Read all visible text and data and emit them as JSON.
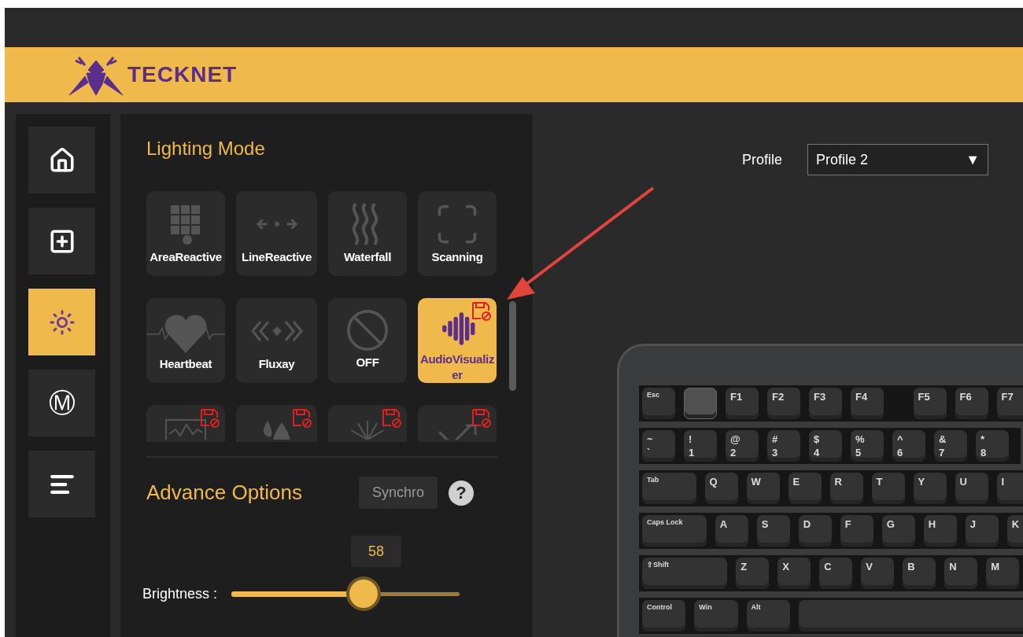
{
  "header": {
    "brand": "TECKNET"
  },
  "sidebar": {
    "items": [
      {
        "kind": "home",
        "selected": false
      },
      {
        "kind": "add",
        "selected": false
      },
      {
        "kind": "light",
        "selected": true
      },
      {
        "kind": "macro",
        "glyph": "Ⓜ",
        "selected": false
      },
      {
        "kind": "list",
        "selected": false
      }
    ]
  },
  "lighting_mode": {
    "title": "Lighting Mode",
    "modes": [
      {
        "kind": "grid",
        "label": "AreaReactive",
        "selected": false,
        "saved": false
      },
      {
        "kind": "line",
        "label": "LineReactive",
        "selected": false,
        "saved": false
      },
      {
        "kind": "waves",
        "label": "Waterfall",
        "selected": false,
        "saved": false
      },
      {
        "kind": "scan",
        "label": "Scanning",
        "selected": false,
        "saved": false
      },
      {
        "kind": "heart",
        "label": "Heartbeat",
        "selected": false,
        "saved": false
      },
      {
        "kind": "chevrons",
        "label": "Fluxay",
        "selected": false,
        "saved": false
      },
      {
        "kind": "off",
        "label": "OFF",
        "selected": false,
        "saved": false
      },
      {
        "kind": "audio",
        "label": "AudioVisualizer",
        "selected": true,
        "saved": true
      },
      {
        "kind": "pulse",
        "selected": false,
        "saved": true
      },
      {
        "kind": "drops",
        "selected": false,
        "saved": true
      },
      {
        "kind": "burst",
        "selected": false,
        "saved": true
      },
      {
        "kind": "arrow",
        "selected": false,
        "saved": true
      }
    ]
  },
  "advance_options": {
    "title": "Advance Options",
    "synchro_button": "Synchro",
    "help": "?",
    "brightness": {
      "label": "Brightness :",
      "value": "58",
      "level": 0.58
    }
  },
  "profile": {
    "label": "Profile",
    "value": "Profile 2",
    "caret": "▼"
  },
  "keyboard": {
    "function_row": [
      {
        "kind": "key",
        "label": "Esc"
      },
      {
        "kind": "blank"
      },
      {
        "kind": "key",
        "label": "F1"
      },
      {
        "kind": "key",
        "label": "F2"
      },
      {
        "kind": "key",
        "label": "F3"
      },
      {
        "kind": "key",
        "label": "F4"
      },
      {
        "kind": "gap"
      },
      {
        "kind": "key",
        "label": "F5"
      },
      {
        "kind": "key",
        "label": "F6"
      },
      {
        "kind": "key",
        "label": "F7"
      }
    ],
    "number_row": [
      {
        "kind": "key",
        "label": "~",
        "sub": "`"
      },
      {
        "kind": "key",
        "label": "!",
        "sub": "1"
      },
      {
        "kind": "key",
        "label": "@",
        "sub": "2"
      },
      {
        "kind": "key",
        "label": "#",
        "sub": "3"
      },
      {
        "kind": "key",
        "label": "$",
        "sub": "4"
      },
      {
        "kind": "key",
        "label": "%",
        "sub": "5"
      },
      {
        "kind": "key",
        "label": "^",
        "sub": "6"
      },
      {
        "kind": "key",
        "label": "&",
        "sub": "7"
      },
      {
        "kind": "key",
        "label": "*",
        "sub": "8"
      }
    ],
    "top_letter_row": [
      {
        "kind": "tab",
        "label": "Tab"
      },
      {
        "kind": "key",
        "label": "Q"
      },
      {
        "kind": "key",
        "label": "W"
      },
      {
        "kind": "key",
        "label": "E"
      },
      {
        "kind": "key",
        "label": "R"
      },
      {
        "kind": "key",
        "label": "T"
      },
      {
        "kind": "key",
        "label": "Y"
      },
      {
        "kind": "key",
        "label": "U"
      },
      {
        "kind": "key",
        "label": "I"
      }
    ],
    "home_row": [
      {
        "kind": "caps",
        "label": "Caps Lock"
      },
      {
        "kind": "key",
        "label": "A"
      },
      {
        "kind": "key",
        "label": "S"
      },
      {
        "kind": "key",
        "label": "D"
      },
      {
        "kind": "key",
        "label": "F"
      },
      {
        "kind": "key",
        "label": "G"
      },
      {
        "kind": "key",
        "label": "H"
      },
      {
        "kind": "key",
        "label": "J"
      },
      {
        "kind": "key",
        "label": "K"
      }
    ],
    "bottom_letter_row": [
      {
        "kind": "shift",
        "label": "⇧Shift"
      },
      {
        "kind": "key",
        "label": "Z"
      },
      {
        "kind": "key",
        "label": "X"
      },
      {
        "kind": "key",
        "label": "C"
      },
      {
        "kind": "key",
        "label": "V"
      },
      {
        "kind": "key",
        "label": "B"
      },
      {
        "kind": "key",
        "label": "N"
      },
      {
        "kind": "key",
        "label": "M"
      }
    ],
    "modifier_row": [
      {
        "kind": "mod",
        "label": "Control"
      },
      {
        "kind": "mod",
        "label": "Win"
      },
      {
        "kind": "mod",
        "label": "Alt"
      },
      {
        "kind": "space"
      }
    ]
  }
}
